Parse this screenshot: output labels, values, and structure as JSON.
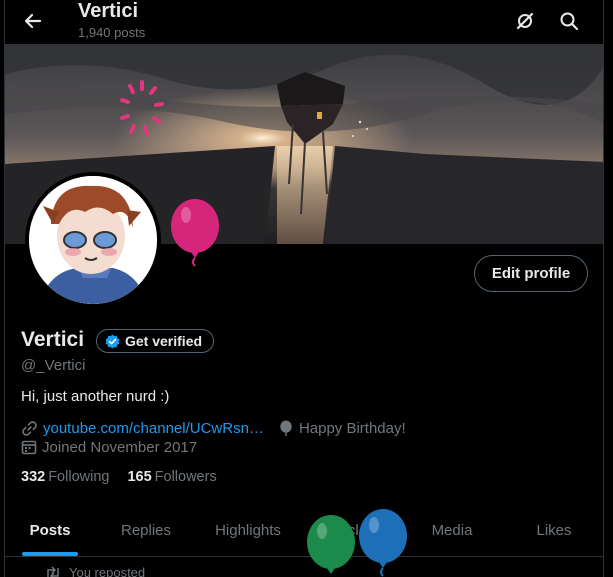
{
  "header": {
    "title": "Vertici",
    "post_count": "1,940 posts"
  },
  "profile": {
    "name": "Vertici",
    "verify_label": "Get verified",
    "handle": "@_Vertici",
    "bio": "Hi, just another nurd :)",
    "website": "youtube.com/channel/UCwRsn…",
    "birthday": "Happy Birthday!",
    "joined": "Joined November 2017",
    "following_count": "332",
    "following_label": "Following",
    "followers_count": "165",
    "followers_label": "Followers",
    "edit_label": "Edit profile"
  },
  "tabs": [
    {
      "label": "Posts",
      "active": true
    },
    {
      "label": "Replies"
    },
    {
      "label": "Highlights"
    },
    {
      "label": "Articles"
    },
    {
      "label": "Media"
    },
    {
      "label": "Likes"
    }
  ],
  "repost_label": "You reposted",
  "colors": {
    "accent": "#1d9bf0",
    "balloon_pink": "#d6267b",
    "balloon_green": "#1b8a4a",
    "balloon_blue": "#1d6fb8"
  }
}
